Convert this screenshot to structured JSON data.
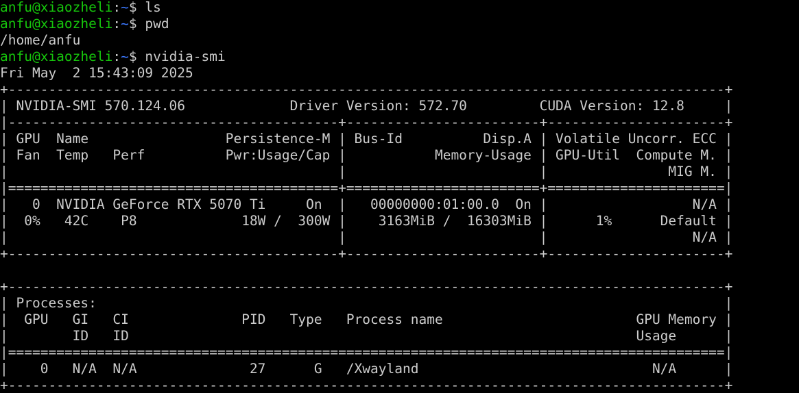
{
  "terminal": {
    "prompt": {
      "user_host": "anfu@xiaozheli",
      "colon": ":",
      "path": "~",
      "symbol": "$ "
    },
    "commands": [
      {
        "command": "ls",
        "output": []
      },
      {
        "command": "pwd",
        "output": [
          "/home/anfu"
        ]
      },
      {
        "command": "nvidia-smi",
        "output": [
          "Fri May  2 15:43:09 2025"
        ]
      }
    ],
    "nvidia_smi": {
      "lines": [
        "+-----------------------------------------------------------------------------------------+",
        "| NVIDIA-SMI 570.124.06             Driver Version: 572.70         CUDA Version: 12.8     |",
        "|-----------------------------------------+------------------------+----------------------+",
        "| GPU  Name                 Persistence-M | Bus-Id          Disp.A | Volatile Uncorr. ECC |",
        "| Fan  Temp   Perf          Pwr:Usage/Cap |           Memory-Usage | GPU-Util  Compute M. |",
        "|                                         |                        |               MIG M. |",
        "|=========================================+========================+======================|",
        "|   0  NVIDIA GeForce RTX 5070 Ti     On  |   00000000:01:00.0  On |                  N/A |",
        "|  0%   42C    P8             18W /  300W |    3163MiB /  16303MiB |      1%      Default |",
        "|                                         |                        |                  N/A |",
        "+-----------------------------------------+------------------------+----------------------+",
        "",
        "+-----------------------------------------------------------------------------------------+",
        "| Processes:                                                                              |",
        "|  GPU   GI   CI              PID   Type   Process name                        GPU Memory |",
        "|        ID   ID                                                               Usage      |",
        "|=========================================================================================|",
        "|    0   N/A  N/A              27      G   /Xwayland                             N/A      |",
        "+-----------------------------------------------------------------------------------------+"
      ]
    }
  }
}
